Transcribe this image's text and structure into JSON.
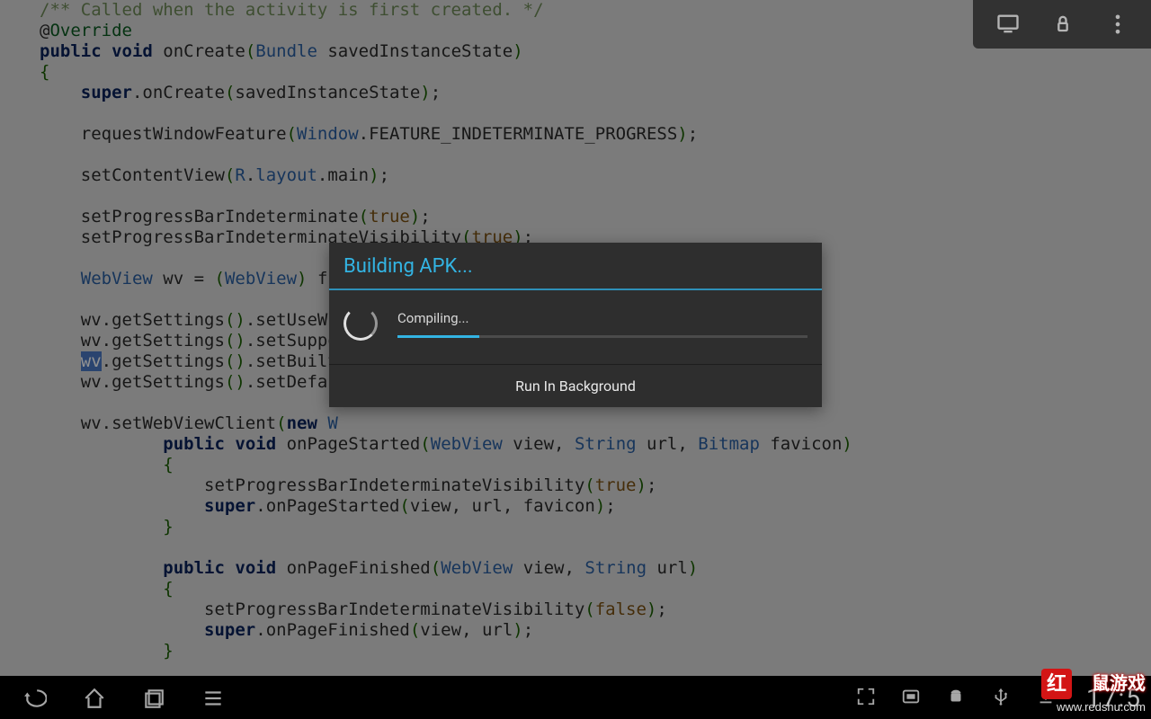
{
  "code": {
    "lines": [
      {
        "t": "comment",
        "text": "/** Called when the activity is first created. */"
      },
      {
        "t": "annotation",
        "text": "@Override"
      },
      {
        "segments": [
          {
            "t": "kw",
            "v": "public"
          },
          {
            "t": "plain",
            "v": " "
          },
          {
            "t": "kw",
            "v": "void"
          },
          {
            "t": "plain",
            "v": " onCreate"
          },
          {
            "t": "paren",
            "v": "("
          },
          {
            "t": "class",
            "v": "Bundle"
          },
          {
            "t": "plain",
            "v": " savedInstanceState"
          },
          {
            "t": "paren",
            "v": ")"
          }
        ]
      },
      {
        "segments": [
          {
            "t": "paren",
            "v": "{"
          }
        ]
      },
      {
        "indent": 1,
        "segments": [
          {
            "t": "kw",
            "v": "super"
          },
          {
            "t": "op",
            "v": "."
          },
          {
            "t": "plain",
            "v": "onCreate"
          },
          {
            "t": "paren",
            "v": "("
          },
          {
            "t": "plain",
            "v": "savedInstanceState"
          },
          {
            "t": "paren",
            "v": ")"
          },
          {
            "t": "op",
            "v": ";"
          }
        ]
      },
      {
        "blank": true
      },
      {
        "indent": 1,
        "segments": [
          {
            "t": "plain",
            "v": "requestWindowFeature"
          },
          {
            "t": "paren",
            "v": "("
          },
          {
            "t": "class",
            "v": "Window"
          },
          {
            "t": "op",
            "v": "."
          },
          {
            "t": "plain",
            "v": "FEATURE_INDETERMINATE_PROGRESS"
          },
          {
            "t": "paren",
            "v": ")"
          },
          {
            "t": "op",
            "v": ";"
          }
        ]
      },
      {
        "blank": true
      },
      {
        "indent": 1,
        "segments": [
          {
            "t": "plain",
            "v": "setContentView"
          },
          {
            "t": "paren",
            "v": "("
          },
          {
            "t": "class",
            "v": "R"
          },
          {
            "t": "op",
            "v": "."
          },
          {
            "t": "class",
            "v": "layout"
          },
          {
            "t": "op",
            "v": "."
          },
          {
            "t": "plain",
            "v": "main"
          },
          {
            "t": "paren",
            "v": ")"
          },
          {
            "t": "op",
            "v": ";"
          }
        ]
      },
      {
        "blank": true
      },
      {
        "indent": 1,
        "segments": [
          {
            "t": "plain",
            "v": "setProgressBarIndeterminate"
          },
          {
            "t": "paren",
            "v": "("
          },
          {
            "t": "bool",
            "v": "true"
          },
          {
            "t": "paren",
            "v": ")"
          },
          {
            "t": "op",
            "v": ";"
          }
        ]
      },
      {
        "indent": 1,
        "segments": [
          {
            "t": "plain",
            "v": "setProgressBarIndeterminateVisibility"
          },
          {
            "t": "paren",
            "v": "("
          },
          {
            "t": "bool",
            "v": "true"
          },
          {
            "t": "paren",
            "v": ")"
          },
          {
            "t": "op",
            "v": ";"
          }
        ]
      },
      {
        "blank": true
      },
      {
        "indent": 1,
        "segments": [
          {
            "t": "class",
            "v": "WebView"
          },
          {
            "t": "plain",
            "v": " wv "
          },
          {
            "t": "op",
            "v": "="
          },
          {
            "t": "plain",
            "v": " "
          },
          {
            "t": "paren",
            "v": "("
          },
          {
            "t": "class",
            "v": "WebView"
          },
          {
            "t": "paren",
            "v": ")"
          },
          {
            "t": "plain",
            "v": " fi"
          }
        ]
      },
      {
        "blank": true
      },
      {
        "indent": 1,
        "segments": [
          {
            "t": "plain",
            "v": "wv"
          },
          {
            "t": "op",
            "v": "."
          },
          {
            "t": "plain",
            "v": "getSettings"
          },
          {
            "t": "paren",
            "v": "()"
          },
          {
            "t": "op",
            "v": "."
          },
          {
            "t": "plain",
            "v": "setUseWi"
          }
        ]
      },
      {
        "indent": 1,
        "segments": [
          {
            "t": "plain",
            "v": "wv"
          },
          {
            "t": "op",
            "v": "."
          },
          {
            "t": "plain",
            "v": "getSettings"
          },
          {
            "t": "paren",
            "v": "()"
          },
          {
            "t": "op",
            "v": "."
          },
          {
            "t": "plain",
            "v": "setSuppo"
          }
        ]
      },
      {
        "indent": 1,
        "segments": [
          {
            "t": "hl",
            "v": "wv"
          },
          {
            "t": "op",
            "v": "."
          },
          {
            "t": "plain",
            "v": "getSettings"
          },
          {
            "t": "paren",
            "v": "()"
          },
          {
            "t": "op",
            "v": "."
          },
          {
            "t": "plain",
            "v": "setBuilt"
          }
        ]
      },
      {
        "indent": 1,
        "segments": [
          {
            "t": "plain",
            "v": "wv"
          },
          {
            "t": "op",
            "v": "."
          },
          {
            "t": "plain",
            "v": "getSettings"
          },
          {
            "t": "paren",
            "v": "()"
          },
          {
            "t": "op",
            "v": "."
          },
          {
            "t": "plain",
            "v": "setDefau"
          }
        ]
      },
      {
        "blank": true
      },
      {
        "indent": 1,
        "segments": [
          {
            "t": "plain",
            "v": "wv"
          },
          {
            "t": "op",
            "v": "."
          },
          {
            "t": "plain",
            "v": "setWebViewClient"
          },
          {
            "t": "paren",
            "v": "("
          },
          {
            "t": "kw",
            "v": "new"
          },
          {
            "t": "plain",
            "v": " "
          },
          {
            "t": "class",
            "v": "W"
          }
        ]
      },
      {
        "indent": 3,
        "segments": [
          {
            "t": "kw",
            "v": "public"
          },
          {
            "t": "plain",
            "v": " "
          },
          {
            "t": "kw",
            "v": "void"
          },
          {
            "t": "plain",
            "v": " onPageStarted"
          },
          {
            "t": "paren",
            "v": "("
          },
          {
            "t": "class",
            "v": "WebView"
          },
          {
            "t": "plain",
            "v": " view"
          },
          {
            "t": "op",
            "v": ","
          },
          {
            "t": "plain",
            "v": " "
          },
          {
            "t": "class",
            "v": "String"
          },
          {
            "t": "plain",
            "v": " url"
          },
          {
            "t": "op",
            "v": ","
          },
          {
            "t": "plain",
            "v": " "
          },
          {
            "t": "class",
            "v": "Bitmap"
          },
          {
            "t": "plain",
            "v": " favicon"
          },
          {
            "t": "paren",
            "v": ")"
          }
        ]
      },
      {
        "indent": 3,
        "segments": [
          {
            "t": "paren",
            "v": "{"
          }
        ]
      },
      {
        "indent": 4,
        "segments": [
          {
            "t": "plain",
            "v": "setProgressBarIndeterminateVisibility"
          },
          {
            "t": "paren",
            "v": "("
          },
          {
            "t": "bool",
            "v": "true"
          },
          {
            "t": "paren",
            "v": ")"
          },
          {
            "t": "op",
            "v": ";"
          }
        ]
      },
      {
        "indent": 4,
        "segments": [
          {
            "t": "kw",
            "v": "super"
          },
          {
            "t": "op",
            "v": "."
          },
          {
            "t": "plain",
            "v": "onPageStarted"
          },
          {
            "t": "paren",
            "v": "("
          },
          {
            "t": "plain",
            "v": "view"
          },
          {
            "t": "op",
            "v": ","
          },
          {
            "t": "plain",
            "v": " url"
          },
          {
            "t": "op",
            "v": ","
          },
          {
            "t": "plain",
            "v": " favicon"
          },
          {
            "t": "paren",
            "v": ")"
          },
          {
            "t": "op",
            "v": ";"
          }
        ]
      },
      {
        "indent": 3,
        "segments": [
          {
            "t": "paren",
            "v": "}"
          }
        ]
      },
      {
        "blank": true
      },
      {
        "indent": 3,
        "segments": [
          {
            "t": "kw",
            "v": "public"
          },
          {
            "t": "plain",
            "v": " "
          },
          {
            "t": "kw",
            "v": "void"
          },
          {
            "t": "plain",
            "v": " onPageFinished"
          },
          {
            "t": "paren",
            "v": "("
          },
          {
            "t": "class",
            "v": "WebView"
          },
          {
            "t": "plain",
            "v": " view"
          },
          {
            "t": "op",
            "v": ","
          },
          {
            "t": "plain",
            "v": " "
          },
          {
            "t": "class",
            "v": "String"
          },
          {
            "t": "plain",
            "v": " url"
          },
          {
            "t": "paren",
            "v": ")"
          }
        ]
      },
      {
        "indent": 3,
        "segments": [
          {
            "t": "paren",
            "v": "{"
          }
        ]
      },
      {
        "indent": 4,
        "segments": [
          {
            "t": "plain",
            "v": "setProgressBarIndeterminateVisibility"
          },
          {
            "t": "paren",
            "v": "("
          },
          {
            "t": "bool",
            "v": "false"
          },
          {
            "t": "paren",
            "v": ")"
          },
          {
            "t": "op",
            "v": ";"
          }
        ]
      },
      {
        "indent": 4,
        "segments": [
          {
            "t": "kw",
            "v": "super"
          },
          {
            "t": "op",
            "v": "."
          },
          {
            "t": "plain",
            "v": "onPageFinished"
          },
          {
            "t": "paren",
            "v": "("
          },
          {
            "t": "plain",
            "v": "view"
          },
          {
            "t": "op",
            "v": ","
          },
          {
            "t": "plain",
            "v": " url"
          },
          {
            "t": "paren",
            "v": ")"
          },
          {
            "t": "op",
            "v": ";"
          }
        ]
      },
      {
        "indent": 3,
        "segments": [
          {
            "t": "paren",
            "v": "}"
          }
        ]
      }
    ]
  },
  "dialog": {
    "title": "Building APK...",
    "status": "Compiling...",
    "progress_percent": 20,
    "action": "Run In Background"
  },
  "navbar": {
    "clock": "17:5",
    "icons_left": [
      "back-icon",
      "home-icon",
      "recent-apps-icon",
      "menu-icon"
    ],
    "icons_right": [
      "fullscreen-icon",
      "screenshot-icon",
      "android-icon",
      "usb-icon",
      "download-icon"
    ]
  },
  "top_toolbar": {
    "icons": [
      "monitor-icon",
      "lock-rotation-icon",
      "overflow-menu-icon"
    ]
  },
  "watermark": {
    "badge": "红",
    "text1": "鼠游戏",
    "text2": "www.redshu.com"
  },
  "colors": {
    "bg": "#d9d9d9",
    "dialog_bg": "#2e2e2e",
    "accent": "#33b4e3",
    "kw": "#0a225a",
    "class": "#2a5ea0",
    "paren": "#1a5e00",
    "bool": "#7a4f10",
    "comment": "#6e8a57",
    "highlight_bg": "#4a78c4"
  }
}
